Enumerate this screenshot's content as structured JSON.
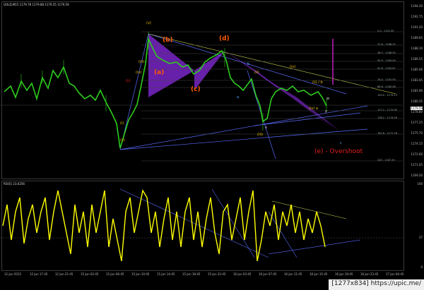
{
  "chart": {
    "header": "GOLD,M15  1179.78 1179.88 1179.55 1179.59",
    "rsi_header": "RSI(5) 23.6256"
  },
  "price_axis": [
    "1194.30",
    "1192.75",
    "1191.20",
    "1189.65",
    "1188.10",
    "1186.55",
    "1185.00",
    "1183.45",
    "1181.90",
    "1180.35",
    "1178.80",
    "1177.25",
    "1175.70",
    "1174.15",
    "1172.60",
    "1171.05",
    "1169.50"
  ],
  "current_price": "1179.59",
  "rsi_axis": {
    "top": "100",
    "mid": "37",
    "bottom": "0"
  },
  "time_axis": [
    "12 Jun 2015",
    "12 Jun 17:45",
    "12 Jun 21:45",
    "15 Jun 02:45",
    "15 Jun 06:45",
    "15 Jun 10:45",
    "15 Jun 14:45",
    "15 Jun 18:45",
    "15 Jun 22:45",
    "16 Jun 03:45",
    "16 Jun 07:45",
    "16 Jun 11:45",
    "16 Jun 15:45",
    "16 Jun 19:45",
    "16 Jun 23:45",
    "17 Jun 04:45"
  ],
  "fib_levels": [
    "0.0 - 1191.05",
    "23.6 - 1188.25",
    "38.2 - 1186.50",
    "50.0 - 1185.09",
    "61.8 - 1183.67",
    "76.4 - 1181.93",
    "88.6 - 1180.48",
    "100.0 - 1179.13",
    "127.2 - 1175.90",
    "138.2 - 1174.59",
    "161.8 - 1171.78",
    "200 - 1167.25"
  ],
  "waves": {
    "a": "(a)",
    "b": "(b)",
    "c": "(c)",
    "d": "(d)",
    "e_overshoot": "(e) - Overshoot"
  },
  "sub_labels": {
    "v_top": "(v)",
    "iii_left": "(iii)",
    "iv_left": "(iv)",
    "ii_left": "(ii)",
    "i_left": "(i)",
    "v_bottom": "(v)",
    "ii_right": "(ii)",
    "iv_right": "(iv)",
    "iii_right": "(iii)",
    "b_blue": "b",
    "a_blue": "a",
    "c_blue": "c",
    "w": "w",
    "x": "x",
    "y": "y",
    "ii_b": "(ii) / b",
    "iv_a": "(iv) a"
  },
  "watermark": "[1277x834] https://upic.me/",
  "colors": {
    "candle": "#2ecc1e",
    "rsi": "#ffff00",
    "triangle": "#8a2be2",
    "trend": "#5a6bff",
    "wave_label": "#ff5a00",
    "overshoot": "#e02020"
  }
}
